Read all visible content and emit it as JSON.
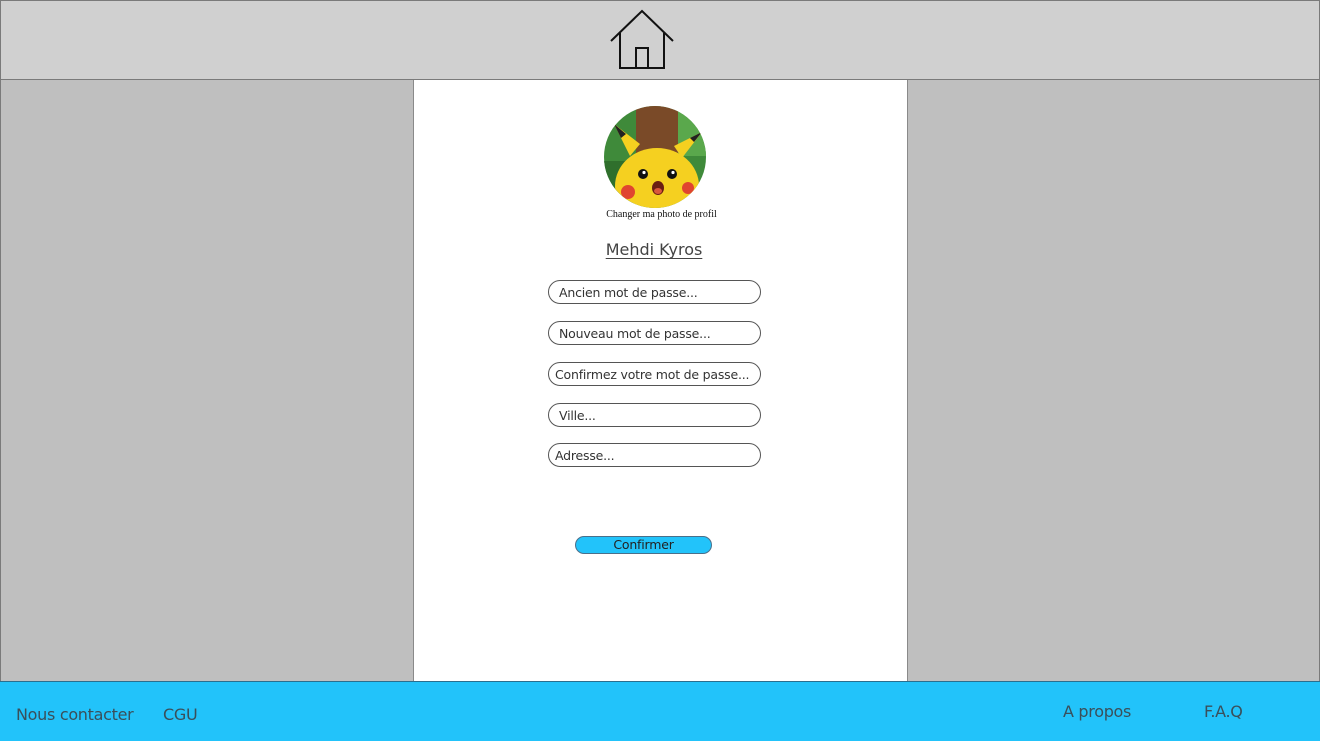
{
  "header": {
    "home_icon": "home-icon"
  },
  "profile": {
    "change_photo_label": "Changer ma photo de profil",
    "username": "Mehdi Kyros"
  },
  "form": {
    "old_password_placeholder": "Ancien mot de passe...",
    "new_password_placeholder": "Nouveau mot de passe...",
    "confirm_password_placeholder": "Confirmez votre mot de passe...",
    "city_placeholder": "Ville...",
    "address_placeholder": "Adresse...",
    "confirm_label": "Confirmer"
  },
  "footer": {
    "contact": "Nous contacter",
    "cgu": "CGU",
    "about": "A propos",
    "faq": "F.A.Q"
  },
  "colors": {
    "accent": "#22c3fa",
    "header_bg": "#d0d0d0",
    "side_bg": "#bfbfbf",
    "panel_bg": "#ffffff"
  }
}
